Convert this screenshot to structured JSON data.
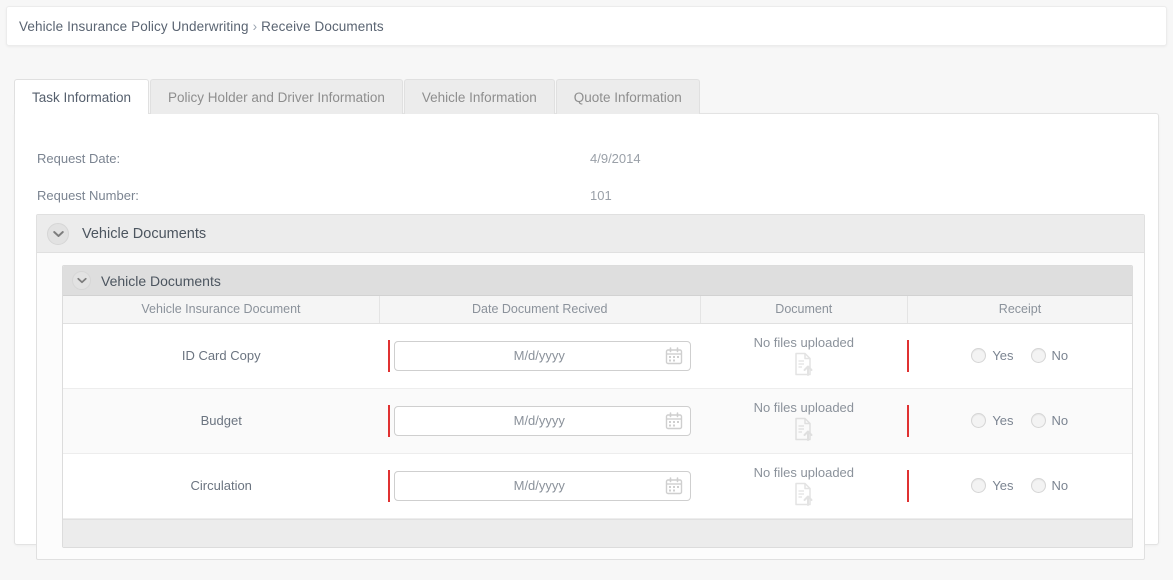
{
  "breadcrumb": {
    "root": "Vehicle Insurance Policy Underwriting",
    "separator": "›",
    "current": "Receive Documents"
  },
  "tabs": [
    {
      "label": "Task Information",
      "active": true
    },
    {
      "label": "Policy Holder and Driver Information",
      "active": false
    },
    {
      "label": "Vehicle Information",
      "active": false
    },
    {
      "label": "Quote Information",
      "active": false
    }
  ],
  "summary_fields": [
    {
      "label": "Request Date:",
      "value": "4/9/2014"
    },
    {
      "label": "Request Number:",
      "value": "101"
    }
  ],
  "outer_section": {
    "title": "Vehicle Documents",
    "chevron_icon": "chevron-down-icon"
  },
  "inner_section": {
    "title": "Vehicle Documents",
    "chevron_icon": "chevron-down-icon"
  },
  "grid": {
    "columns": [
      "Vehicle Insurance Document",
      "Date Document Recived",
      "Document",
      "Receipt"
    ],
    "rows": [
      {
        "document": "ID Card Copy",
        "date_placeholder": "M/d/yyyy",
        "date_value": "",
        "files_status": "No files uploaded",
        "upload_icon": "file-upload-icon",
        "calendar_icon": "calendar-icon",
        "receipt_yes": "Yes",
        "receipt_no": "No",
        "receipt_selected": ""
      },
      {
        "document": "Budget",
        "date_placeholder": "M/d/yyyy",
        "date_value": "",
        "files_status": "No files uploaded",
        "upload_icon": "file-upload-icon",
        "calendar_icon": "calendar-icon",
        "receipt_yes": "Yes",
        "receipt_no": "No",
        "receipt_selected": ""
      },
      {
        "document": "Circulation",
        "date_placeholder": "M/d/yyyy",
        "date_value": "",
        "files_status": "No files uploaded",
        "upload_icon": "file-upload-icon",
        "calendar_icon": "calendar-icon",
        "receipt_yes": "Yes",
        "receipt_no": "No",
        "receipt_selected": ""
      }
    ]
  },
  "colors": {
    "required_marker": "#e03131",
    "header_band": "#ececec",
    "inner_header_band": "#dedede",
    "text_primary": "#4c555f",
    "text_muted": "#8b929b"
  }
}
